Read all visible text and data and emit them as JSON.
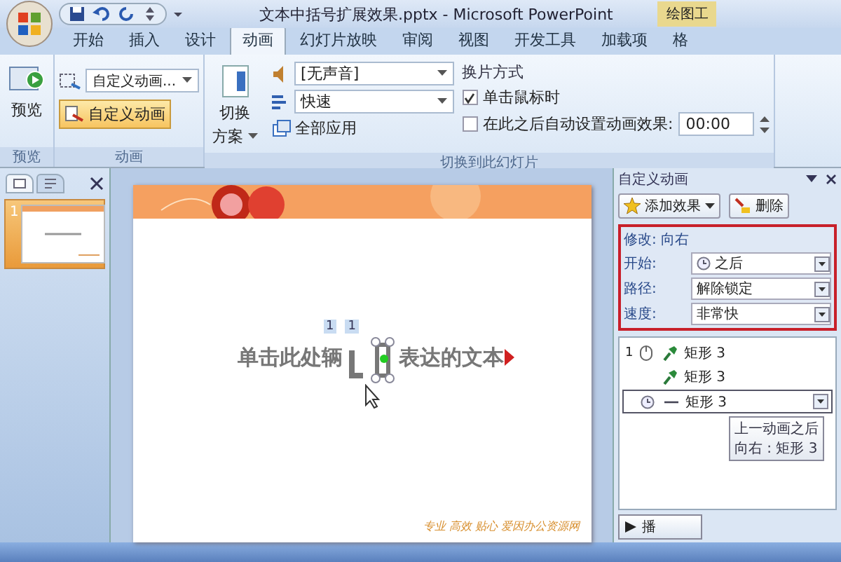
{
  "window": {
    "title": "文本中括号扩展效果.pptx - Microsoft PowerPoint",
    "contextual_tab": "绘图工"
  },
  "tabs": [
    {
      "label": "开始",
      "selected": false
    },
    {
      "label": "插入",
      "selected": false
    },
    {
      "label": "设计",
      "selected": false
    },
    {
      "label": "动画",
      "selected": true
    },
    {
      "label": "幻灯片放映",
      "selected": false
    },
    {
      "label": "审阅",
      "selected": false
    },
    {
      "label": "视图",
      "selected": false
    },
    {
      "label": "开发工具",
      "selected": false
    },
    {
      "label": "加载项",
      "selected": false
    },
    {
      "label": "格",
      "selected": false
    }
  ],
  "ribbon": {
    "preview": {
      "button": "预览",
      "group": "预览"
    },
    "animation": {
      "dropdown": "自定义动画...",
      "button": "自定义动画",
      "button_on": true,
      "group": "动画"
    },
    "transition": {
      "scheme_button": [
        "切换",
        "方案"
      ],
      "sound": "[无声音]",
      "speed": "快速",
      "apply_all": "全部应用",
      "advance_title": "换片方式",
      "on_click": {
        "label": "单击鼠标时",
        "checked": true
      },
      "auto": {
        "label": "在此之后自动设置动画效果:",
        "checked": false
      },
      "time": "00:00",
      "group": "切换到此幻灯片"
    }
  },
  "slide_panel": {
    "tabs": [
      {
        "kind": "slides",
        "selected": true
      },
      {
        "kind": "outline",
        "selected": false
      }
    ],
    "slides": [
      {
        "number": "1",
        "selected": true
      }
    ]
  },
  "slide": {
    "texts": [
      "单击此处辆",
      "表达的文本"
    ],
    "badges": [
      "1",
      "1"
    ],
    "footer": "专业 高效 贴心   爱因办公资源网"
  },
  "task_pane": {
    "title": "自定义动画",
    "add_button": "添加效果",
    "remove_button": "删除",
    "modify": "修改: 向右",
    "fields": [
      {
        "label": "开始:",
        "value": "之后",
        "kind": "timing"
      },
      {
        "label": "路径:",
        "value": "解除锁定",
        "kind": "plain"
      },
      {
        "label": "速度:",
        "value": "非常快",
        "kind": "plain"
      }
    ],
    "effects": [
      {
        "order": "1",
        "kind": "click",
        "name": "矩形 3",
        "selected": false
      },
      {
        "kind": "with",
        "name": "矩形 3",
        "selected": false
      },
      {
        "kind": "after",
        "name": "矩形 3",
        "selected": true
      }
    ],
    "tooltip": [
      "上一动画之后",
      "向右 : 矩形 3"
    ],
    "play_button": "播"
  }
}
